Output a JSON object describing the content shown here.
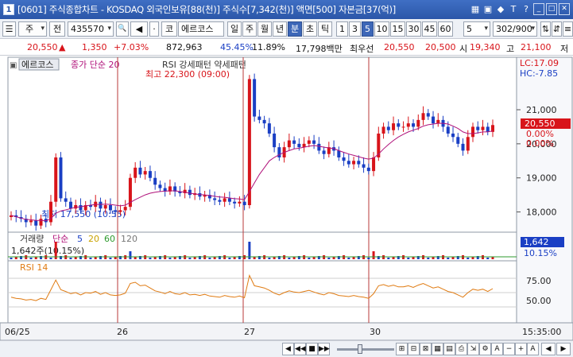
{
  "window": {
    "app_number": "1",
    "title": "[0601] 주식종합차트 - KOSDAQ 외국인보유[88(천)] 주식수[7,342(천)] 액면[500] 자본금[37(억)]",
    "icons": [
      "grid-icon",
      "box-icon",
      "diamond-icon",
      "text-t-icon",
      "help-icon",
      "minimize-icon",
      "restore-icon",
      "close-icon"
    ],
    "glyphs": [
      "▦",
      "▣",
      "◆",
      "T",
      "?",
      "_",
      "□",
      "✕"
    ]
  },
  "toolbar": {
    "menu_label": "☰",
    "period_label": "주",
    "prev_label": "전",
    "code_value": "435570",
    "search_glyph": "🔍",
    "speaker_glyph": "◀",
    "dot_label": "·",
    "market_label": "코",
    "stock_name": "에르코스",
    "period_tabs": [
      "일",
      "주",
      "월",
      "년",
      "분",
      "초",
      "틱"
    ],
    "active_period": "분",
    "interval_tabs": [
      "1",
      "3",
      "5",
      "10",
      "15",
      "30",
      "45",
      "60"
    ],
    "active_interval": "5",
    "interval_select": "5",
    "count_value": "302/900",
    "tool_glyphs": [
      "⇅",
      "⇵",
      "≡"
    ]
  },
  "info": {
    "price": "20,550",
    "change_arrow": "▲",
    "change": "1,350",
    "change_pct": "+7.03%",
    "volume": "872,963",
    "vol_ratio": "45.45%",
    "turnover": "11.89%",
    "amount": "17,798백만",
    "level_label": "최우선",
    "ask": "20,550",
    "bid": "20,500",
    "open_label": "시",
    "open": "19,340",
    "high_label": "고",
    "high": "21,100",
    "extra": "저"
  },
  "chart": {
    "stock_tag": "에르코스",
    "ma_legend": "종가 단순 20",
    "rsi_overlay": "RSI 강세패턴  약세패턴",
    "max_note": "최고 22,300 (09:00)",
    "min_note": "최저 17,550 (10:55)",
    "lc_label": "LC:17.09",
    "hc_label": "HC:-7.85",
    "price_ticks": [
      "21,000",
      "20,000",
      "19,000",
      "18,000"
    ],
    "price_tag": "20,550",
    "pct_tag": "0.00%",
    "pct_tag2": "0.00%",
    "vol_legend_name": "거래량",
    "vol_legend_ma": "단순",
    "vol_legend_periods": [
      "5",
      "20",
      "60",
      "120"
    ],
    "vol_value": "1,642주(10.15%)",
    "vol_tag": "1,642",
    "vol_tag_pct": "10.15%",
    "rsi_legend": "RSI 14",
    "rsi_ticks": [
      "75.00",
      "50.00"
    ],
    "date_labels": [
      "06/25",
      "26",
      "27",
      "30"
    ],
    "time_label": "15:35:00",
    "colors": {
      "up": "#d8141a",
      "down": "#1a3fc4",
      "ma": "#b0117a",
      "rsi": "#e07b12",
      "divider": "#b93a3a"
    }
  },
  "chart_data": {
    "type": "candlestick",
    "title": "에르코스",
    "series": [
      {
        "name": "종가",
        "values": [
          17.9,
          17.85,
          17.8,
          17.7,
          17.75,
          17.6,
          17.8,
          17.7,
          18.3,
          19.6,
          18.4,
          18.3,
          18.1,
          18.2,
          18.05,
          18.2,
          18.15,
          18.3,
          18.1,
          18.2,
          18.05,
          18.0,
          18.05,
          18.15,
          19.0,
          19.3,
          19.1,
          19.2,
          19.0,
          18.8,
          18.7,
          18.6,
          18.75,
          18.6,
          18.55,
          18.65,
          18.5,
          18.55,
          18.45,
          18.5,
          18.4,
          18.35,
          18.3,
          18.4,
          18.3,
          18.25,
          18.3,
          18.2,
          21.9,
          20.8,
          20.7,
          20.6,
          20.3,
          19.9,
          19.6,
          19.9,
          20.1,
          20.0,
          19.9,
          20.0,
          20.1,
          20.0,
          19.8,
          19.7,
          19.9,
          19.8,
          19.6,
          19.5,
          19.4,
          19.5,
          19.4,
          19.3,
          19.2,
          19.6,
          20.3,
          20.5,
          20.4,
          20.6,
          20.5,
          20.5,
          20.6,
          20.5,
          20.7,
          20.9,
          20.8,
          20.6,
          20.7,
          20.5,
          20.3,
          20.2,
          20.0,
          19.8,
          20.2,
          20.5,
          20.4,
          20.5,
          20.35,
          20.55
        ]
      },
      {
        "name": "종가 단순 20",
        "values": [
          17.9,
          17.86,
          17.82,
          17.78,
          17.77,
          17.75,
          17.75,
          17.74,
          17.8,
          17.96,
          18.03,
          18.06,
          18.1,
          18.14,
          18.15,
          18.18,
          18.2,
          18.22,
          18.22,
          18.23,
          18.22,
          18.2,
          18.18,
          18.2,
          18.28,
          18.36,
          18.43,
          18.5,
          18.55,
          18.58,
          18.6,
          18.61,
          18.62,
          18.62,
          18.6,
          18.58,
          18.55,
          18.53,
          18.51,
          18.5,
          18.48,
          18.46,
          18.44,
          18.43,
          18.41,
          18.39,
          18.38,
          18.36,
          18.6,
          18.85,
          19.1,
          19.3,
          19.5,
          19.6,
          19.68,
          19.75,
          19.8,
          19.85,
          19.87,
          19.9,
          19.93,
          19.95,
          19.93,
          19.9,
          19.88,
          19.86,
          19.8,
          19.75,
          19.7,
          19.66,
          19.62,
          19.58,
          19.55,
          19.58,
          19.7,
          19.85,
          19.98,
          20.1,
          20.2,
          20.28,
          20.35,
          20.4,
          20.45,
          20.52,
          20.56,
          20.58,
          20.6,
          20.6,
          20.58,
          20.52,
          20.45,
          20.35,
          20.3,
          20.3,
          20.32,
          20.35,
          20.35,
          20.38
        ]
      },
      {
        "name": "RSI 14",
        "values": [
          42,
          40,
          39,
          37,
          38,
          36,
          40,
          38,
          55,
          72,
          55,
          52,
          48,
          50,
          46,
          50,
          49,
          52,
          47,
          50,
          46,
          45,
          46,
          49,
          66,
          68,
          62,
          63,
          58,
          53,
          51,
          48,
          52,
          48,
          47,
          50,
          46,
          47,
          45,
          47,
          44,
          43,
          42,
          45,
          43,
          42,
          44,
          41,
          80,
          62,
          60,
          58,
          54,
          49,
          46,
          50,
          53,
          51,
          50,
          52,
          54,
          51,
          48,
          46,
          50,
          48,
          45,
          44,
          43,
          45,
          43,
          42,
          40,
          48,
          62,
          64,
          61,
          63,
          60,
          60,
          62,
          59,
          63,
          66,
          62,
          58,
          60,
          56,
          52,
          50,
          46,
          42,
          50,
          56,
          54,
          56,
          52,
          57
        ]
      }
    ],
    "ylim": [
      17.5,
      22.4
    ],
    "xlabel": "",
    "ylabel": ""
  }
}
